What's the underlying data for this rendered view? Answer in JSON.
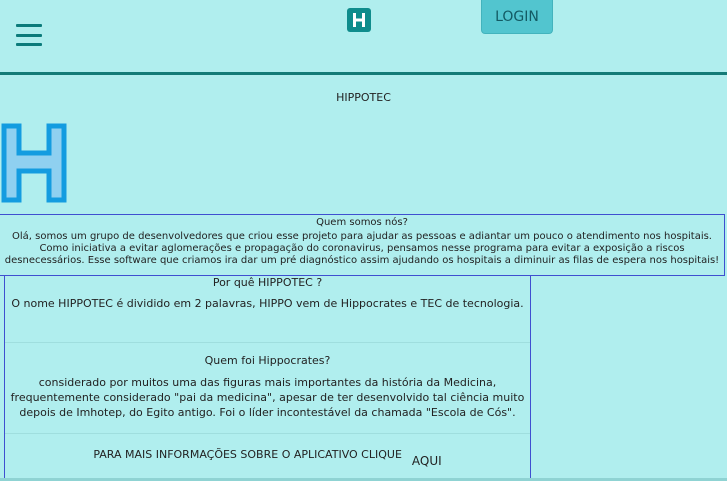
{
  "header": {
    "logo_letter": "H",
    "login_label": "LOGIN"
  },
  "site": {
    "title": "HIPPOTEC",
    "logo_letter": "H"
  },
  "about": {
    "heading": "Quem somos nós?",
    "text": "Olá, somos um grupo de desenvolvedores que criou esse projeto para ajudar as pessoas e adiantar um pouco o atendimento nos hospitais. Como iniciativa a evitar aglomerações e propagação do coronavirus, pensamos nesse programa para evitar a exposição a riscos desnecessários. Esse software que criamos ira dar um pré diagnóstico assim ajudando os hospitais a diminuir as filas de espera nos hospitais!"
  },
  "why": {
    "heading": "Por quê HIPPOTEC ?",
    "text": "O nome HIPPOTEC é dividido em 2 palavras, HIPPO vem de Hippocrates e TEC de tecnologia."
  },
  "who": {
    "heading": "Quem foi Hippocrates?",
    "text": "considerado por muitos uma das figuras mais importantes da história da Medicina, frequentemente considerado \"pai da medicina\", apesar de ter desenvolvido tal ciência muito depois de Imhotep, do Egito antigo. Foi o líder incontestável da chamada \"Escola de Cós\"."
  },
  "more": {
    "text": "PARA MAIS INFORMAÇÕES SOBRE O APLICATIVO CLIQUE",
    "link_label": "AQUI"
  },
  "colors": {
    "background": "#b0eeee",
    "accent": "#0f8c8c",
    "login_button": "#52c5cf",
    "big_logo": "#139ce0",
    "border": "#3f4fd0"
  }
}
